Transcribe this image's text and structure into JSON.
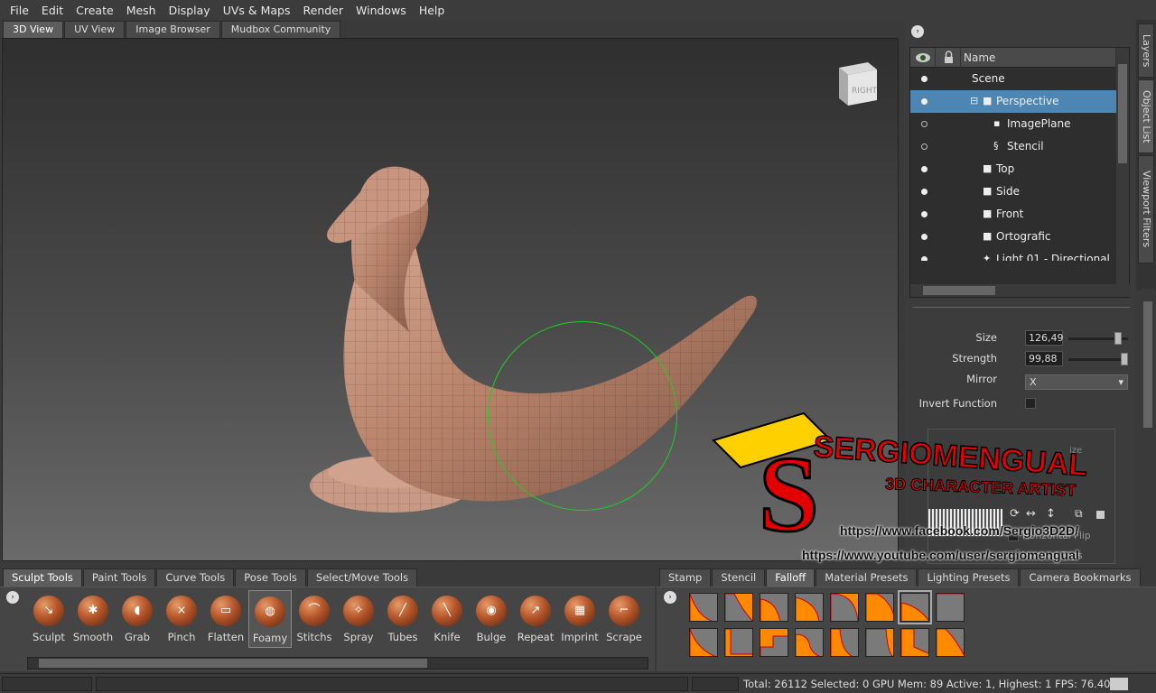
{
  "menu": [
    "File",
    "Edit",
    "Create",
    "Mesh",
    "Display",
    "UVs & Maps",
    "Render",
    "Windows",
    "Help"
  ],
  "view_tabs": [
    "3D View",
    "UV View",
    "Image Browser",
    "Mudbox Community"
  ],
  "viewcube_label": "RIGHT",
  "object_list": {
    "header_name": "Name",
    "rows": [
      {
        "label": "Scene"
      },
      {
        "label": "Perspective"
      },
      {
        "label": "ImagePlane"
      },
      {
        "label": "Stencil"
      },
      {
        "label": "Top"
      },
      {
        "label": "Side"
      },
      {
        "label": "Front"
      },
      {
        "label": "Ortografic"
      },
      {
        "label": "Light 01 - Directional"
      }
    ]
  },
  "side_tabs": [
    "Layers",
    "Object List",
    "Viewport Filters"
  ],
  "properties": {
    "size_label": "Size",
    "size_value": "126,49",
    "size_level": 0.88,
    "strength_label": "Strength",
    "strength_value": "99,88",
    "strength_level": 0.998,
    "mirror_label": "Mirror",
    "mirror_value": "X",
    "invert_label": "Invert Function",
    "partial_label": "ize",
    "horizontal_flip": "Horizontal Flip",
    "vertical_flip": "Vertical Flips"
  },
  "tool_tabs": [
    "Sculpt Tools",
    "Paint Tools",
    "Curve Tools",
    "Pose Tools",
    "Select/Move Tools"
  ],
  "tools": [
    "Sculpt",
    "Smooth",
    "Grab",
    "Pinch",
    "Flatten",
    "Foamy",
    "Stitchs",
    "Spray",
    "Tubes",
    "Knife",
    "Bulge",
    "Repeat",
    "Imprint",
    "Scrape"
  ],
  "tools_icons": [
    "sculpt-icon",
    "smooth-icon",
    "grab-icon",
    "pinch-icon",
    "flatten-icon",
    "foamy-icon",
    "stitchs-icon",
    "spray-icon",
    "tubes-icon",
    "knife-icon",
    "bulge-icon",
    "repeat-icon",
    "imprint-icon",
    "scrape-icon"
  ],
  "preset_tabs": [
    "Stamp",
    "Stencil",
    "Falloff",
    "Material Presets",
    "Lighting Presets",
    "Camera Bookmarks"
  ],
  "status": {
    "text": "Total: 26112  Selected: 0 GPU Mem: 89  Active: 1, Highest: 1  FPS: 76.4025"
  },
  "watermark": {
    "title": "SERGIOMENGUAL",
    "subtitle": "3D CHARACTER ARTIST",
    "facebook": "https://www.facebook.com/Sergio3D2D/",
    "youtube": "https://www.youtube.com/user/sergiomengual"
  },
  "colors": {
    "selection": "#4d86b3",
    "brush_ring": "#1fd01f",
    "falloff": "#ff8a00",
    "tool_ball": "#b4562a"
  }
}
